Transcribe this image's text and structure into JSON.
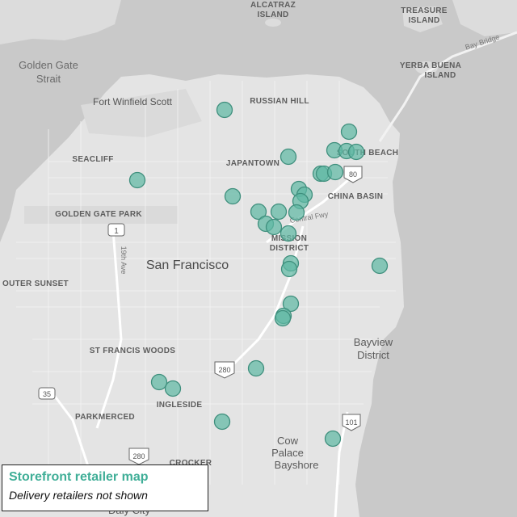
{
  "map": {
    "labels": {
      "alcatraz_1": "ALCATRAZ",
      "alcatraz_2": "ISLAND",
      "treasure_1": "TREASURE",
      "treasure_2": "ISLAND",
      "yerba_1": "YERBA BUENA",
      "yerba_2": "ISLAND",
      "golden_gate_1": "Golden Gate",
      "golden_gate_2": "Strait",
      "bay_bridge": "Bay Bridge",
      "fort_winfield": "Fort Winfield Scott",
      "russian_hill": "RUSSIAN HILL",
      "seacliff": "SEACLIFF",
      "japantown": "JAPANTOWN",
      "south_beach": "SOUTH BEACH",
      "china_basin": "CHINA BASIN",
      "golden_gate_park": "GOLDEN GATE PARK",
      "central_fwy": "Central Fwy",
      "mission_1": "MISSION",
      "mission_2": "DISTRICT",
      "san_francisco": "San Francisco",
      "outer_sunset": "OUTER SUNSET",
      "nineteenth_ave": "19th Ave",
      "st_francis_woods": "ST FRANCIS WOODS",
      "bayview_1": "Bayview",
      "bayview_2": "District",
      "ingleside": "INGLESIDE",
      "parkmerced": "PARKMERCED",
      "cow_palace_1": "Cow",
      "cow_palace_2": "Palace",
      "bayshore": "Bayshore",
      "crocker": "CROCKER",
      "daly_city": "Daly City"
    },
    "shields": {
      "hwy_1": "1",
      "i_80": "80",
      "i_280_north": "280",
      "i_280_south": "280",
      "hwy_35": "35",
      "us_101": "101"
    },
    "colors": {
      "water": "#c9c9c9",
      "land": "#e4e4e4",
      "marker_fill": "#5fb8a3",
      "marker_stroke": "#3f8f7d",
      "legend_title": "#3fae97"
    }
  },
  "legend": {
    "title": "Storefront retailer map",
    "subtitle": "Delivery retailers not shown"
  }
}
